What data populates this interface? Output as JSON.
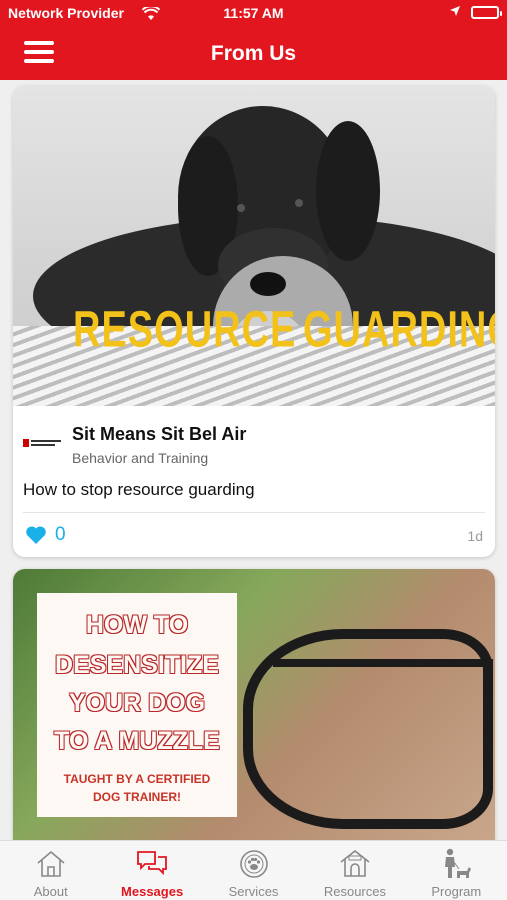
{
  "status_bar": {
    "carrier": "Network Provider",
    "time": "11:57 AM"
  },
  "header": {
    "title": "From Us",
    "menu_icon": "hamburger-menu-icon"
  },
  "posts": [
    {
      "image_text": [
        "RESOURCE",
        "GUARDING"
      ],
      "author": "Sit Means Sit Bel Air",
      "category": "Behavior and Training",
      "title": "How to stop resource guarding",
      "likes": "0",
      "age": "1d"
    },
    {
      "image_text": [
        "HOW TO",
        "DESENSITIZE",
        "YOUR DOG",
        "TO A MUZZLE"
      ],
      "image_subtitle": [
        "TAUGHT BY A CERTIFIED",
        "DOG TRAINER!"
      ]
    }
  ],
  "tabs": [
    {
      "label": "About",
      "icon": "house-icon",
      "active": false
    },
    {
      "label": "Messages",
      "icon": "chat-bubbles-icon",
      "active": true
    },
    {
      "label": "Services",
      "icon": "paw-badge-icon",
      "active": false
    },
    {
      "label": "Resources",
      "icon": "dog-house-icon",
      "active": false
    },
    {
      "label": "Program",
      "icon": "trainer-dog-icon",
      "active": false
    }
  ],
  "colors": {
    "brand": "#e2161f",
    "like": "#1ab0e8",
    "tab_inactive": "#888888"
  }
}
